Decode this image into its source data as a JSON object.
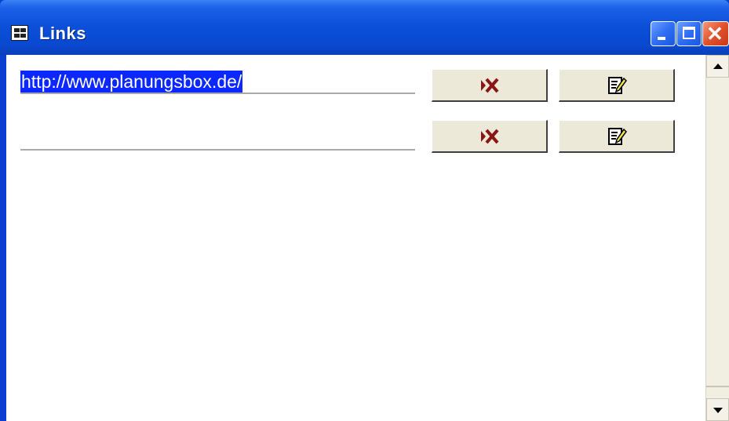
{
  "window": {
    "title": "Links",
    "icon": "form-icon",
    "controls": [
      "minimize",
      "maximize",
      "close"
    ]
  },
  "rows": [
    {
      "url": "http://www.planungsbox.de/",
      "selected": true,
      "delete_icon": "delete-x-icon",
      "edit_icon": "edit-note-icon"
    },
    {
      "url": "",
      "selected": false,
      "delete_icon": "delete-x-icon",
      "edit_icon": "edit-note-icon"
    }
  ],
  "colors": {
    "titlebar": "#0a48cf",
    "selection": "#0a28ff",
    "delete_glyph": "#8b1414",
    "edit_glyph": "#f2e64a",
    "button_face": "#ece9d8"
  }
}
